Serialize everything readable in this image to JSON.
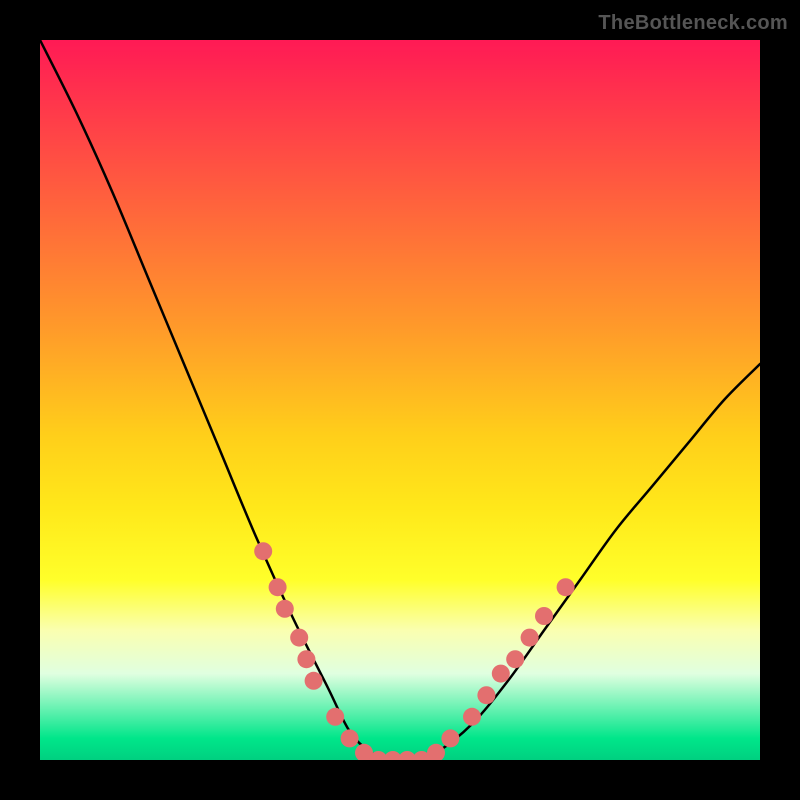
{
  "watermark": "TheBottleneck.com",
  "chart_data": {
    "type": "line",
    "title": "",
    "xlabel": "",
    "ylabel": "",
    "xlim": [
      0,
      100
    ],
    "ylim": [
      0,
      100
    ],
    "gradient_stops": [
      {
        "pos": 0,
        "color": "#ff1a55"
      },
      {
        "pos": 10,
        "color": "#ff3a4a"
      },
      {
        "pos": 25,
        "color": "#ff6a3a"
      },
      {
        "pos": 40,
        "color": "#ff9a2a"
      },
      {
        "pos": 55,
        "color": "#ffcf1a"
      },
      {
        "pos": 65,
        "color": "#ffe81a"
      },
      {
        "pos": 75,
        "color": "#ffff2a"
      },
      {
        "pos": 82,
        "color": "#faffb0"
      },
      {
        "pos": 88,
        "color": "#e0ffe0"
      },
      {
        "pos": 97,
        "color": "#00e68a"
      },
      {
        "pos": 100,
        "color": "#00d080"
      }
    ],
    "series": [
      {
        "name": "bottleneck-curve",
        "x": [
          0,
          5,
          10,
          15,
          20,
          25,
          30,
          35,
          40,
          43,
          46,
          49,
          52,
          55,
          60,
          65,
          70,
          75,
          80,
          85,
          90,
          95,
          100
        ],
        "values": [
          100,
          90,
          79,
          67,
          55,
          43,
          31,
          20,
          10,
          4,
          1,
          0,
          0,
          1,
          5,
          11,
          18,
          25,
          32,
          38,
          44,
          50,
          55
        ]
      }
    ],
    "markers": {
      "name": "highlight-points",
      "color": "#e36f6f",
      "radius": 9,
      "points": [
        {
          "x": 31,
          "y": 29
        },
        {
          "x": 33,
          "y": 24
        },
        {
          "x": 34,
          "y": 21
        },
        {
          "x": 36,
          "y": 17
        },
        {
          "x": 37,
          "y": 14
        },
        {
          "x": 38,
          "y": 11
        },
        {
          "x": 41,
          "y": 6
        },
        {
          "x": 43,
          "y": 3
        },
        {
          "x": 45,
          "y": 1
        },
        {
          "x": 47,
          "y": 0
        },
        {
          "x": 49,
          "y": 0
        },
        {
          "x": 51,
          "y": 0
        },
        {
          "x": 53,
          "y": 0
        },
        {
          "x": 55,
          "y": 1
        },
        {
          "x": 57,
          "y": 3
        },
        {
          "x": 60,
          "y": 6
        },
        {
          "x": 62,
          "y": 9
        },
        {
          "x": 64,
          "y": 12
        },
        {
          "x": 66,
          "y": 14
        },
        {
          "x": 68,
          "y": 17
        },
        {
          "x": 70,
          "y": 20
        },
        {
          "x": 73,
          "y": 24
        }
      ]
    }
  }
}
